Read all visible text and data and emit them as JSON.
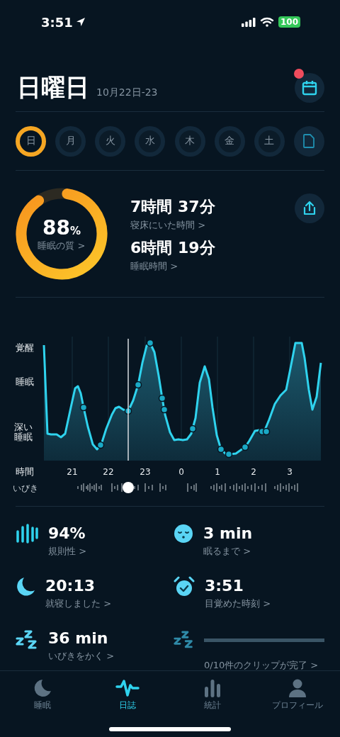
{
  "status_bar": {
    "time": "3:51",
    "battery": "100"
  },
  "header": {
    "title": "日曜日",
    "date_range": "10月22日-23",
    "calendar_notification": true
  },
  "days": [
    {
      "label": "日",
      "selected": true
    },
    {
      "label": "月",
      "selected": false
    },
    {
      "label": "火",
      "selected": false
    },
    {
      "label": "水",
      "selected": false
    },
    {
      "label": "木",
      "selected": false
    },
    {
      "label": "金",
      "selected": false
    },
    {
      "label": "土",
      "selected": false
    }
  ],
  "summary": {
    "quality": {
      "value": "88",
      "unit": "%",
      "label": "睡眠の質 >",
      "level": 0.88
    },
    "durations": [
      {
        "value": "7時間 37分",
        "label": "寝床にいた時間 >"
      },
      {
        "value": "6時間 19分",
        "label": "睡眠時間 >"
      }
    ]
  },
  "hypnogram": {
    "y_labels": [
      "覚醒",
      "睡眠",
      "深い睡眠"
    ],
    "x_title": "時間",
    "x_labels": [
      "21",
      "22",
      "23",
      "0",
      "1",
      "2",
      "3"
    ],
    "snore_label": "いびき"
  },
  "stats": [
    {
      "kind": "metric",
      "value": "94%",
      "label": "規則性 >"
    },
    {
      "kind": "metric",
      "value": "3 min",
      "label": "眠るまで >"
    },
    {
      "kind": "metric",
      "value": "20:13",
      "label": "就寝しました >"
    },
    {
      "kind": "metric",
      "value": "3:51",
      "label": "目覚めた時刻 >"
    },
    {
      "kind": "metric",
      "value": "36 min",
      "label": "いびきをかく >"
    },
    {
      "kind": "progress",
      "level": 0,
      "label": "0/10件のクリップが完了 >"
    }
  ],
  "tab_bar": [
    {
      "label": "睡眠",
      "selected": false
    },
    {
      "label": "日誌",
      "selected": true
    },
    {
      "label": "統計",
      "selected": false
    },
    {
      "label": "プロフィール",
      "selected": false
    }
  ]
}
